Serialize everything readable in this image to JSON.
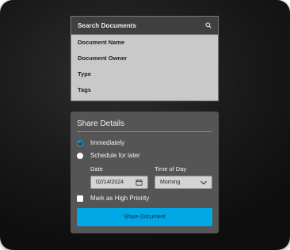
{
  "search": {
    "placeholder": "Search Documents",
    "options": [
      "Document Name",
      "Document Owner",
      "Type",
      "Tags"
    ]
  },
  "share": {
    "title": "Share Details",
    "radio_immediately": "Immediately",
    "radio_schedule": "Schedule for later",
    "selected_option": "Immediately",
    "date_label": "Date",
    "date_value": "02/14/2024",
    "time_label": "Time of Day",
    "time_value": "Morning",
    "priority_label": "Mark as High Priority",
    "priority_checked": false,
    "button_label": "Share Document"
  },
  "colors": {
    "accent": "#00a8e6",
    "radio_selected": "#29a0dc",
    "panel_bg": "#555555",
    "dropdown_bg": "#c9c9c9"
  },
  "icons": {
    "search": "search-icon",
    "calendar": "calendar-icon",
    "chevron": "chevron-down-icon"
  }
}
